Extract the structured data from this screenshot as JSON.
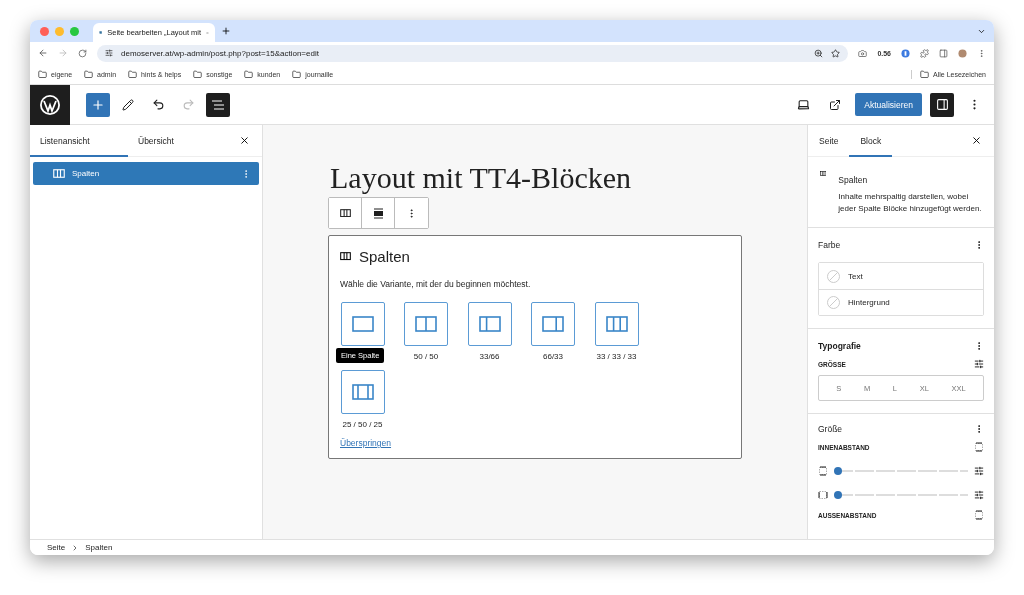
{
  "browser": {
    "tab_title": "Seite bearbeiten „Layout mit",
    "url": "demoserver.at/wp-admin/post.php?post=15&action=edit",
    "extension_badge": "0.56",
    "bookmarks": [
      "eigene",
      "admin",
      "hints & helps",
      "sonstige",
      "kunden",
      "journaille"
    ],
    "all_bookmarks": "Alle Lesezeichen"
  },
  "toolbar": {
    "update_button": "Aktualisieren"
  },
  "list_view": {
    "tabs": [
      {
        "label": "Listenansicht",
        "selected": true
      },
      {
        "label": "Übersicht",
        "selected": false
      }
    ],
    "items": [
      {
        "label": "Spalten",
        "selected": true
      }
    ]
  },
  "canvas": {
    "title": "Layout mit TT4-Blöcken",
    "placeholder": {
      "title": "Spalten",
      "instruction": "Wähle die Variante, mit der du beginnen möchtest.",
      "variants": [
        {
          "kind": "one",
          "tooltip": "Eine Spalte"
        },
        {
          "kind": "half",
          "label": "50 / 50"
        },
        {
          "kind": "third-left",
          "label": "33/66"
        },
        {
          "kind": "third-right",
          "label": "66/33"
        },
        {
          "kind": "thirds",
          "label": "33 / 33 / 33"
        },
        {
          "kind": "wide-center",
          "label": "25 / 50 / 25"
        }
      ],
      "skip_link": "Überspringen"
    }
  },
  "inspector": {
    "tabs": [
      {
        "label": "Seite",
        "selected": false
      },
      {
        "label": "Block",
        "selected": true
      }
    ],
    "block": {
      "name": "Spalten",
      "description": "Inhalte mehrspaltig darstellen, wobei jeder Spalte Blöcke hinzugefügt werden."
    },
    "color": {
      "title": "Farbe",
      "items": [
        "Text",
        "Hintergrund"
      ]
    },
    "typography": {
      "title": "Typografie",
      "size_label": "GRÖSSE",
      "sizes": [
        "S",
        "M",
        "L",
        "XL",
        "XXL"
      ]
    },
    "dimensions": {
      "title": "Größe",
      "padding_label": "INNENABSTAND",
      "sliders": [
        {
          "kind": "vertical",
          "level": 0
        },
        {
          "kind": "horizontal",
          "level": 0
        }
      ],
      "margin_label": "AUSSENABSTAND"
    }
  },
  "breadcrumb": [
    "Seite",
    "Spalten"
  ]
}
